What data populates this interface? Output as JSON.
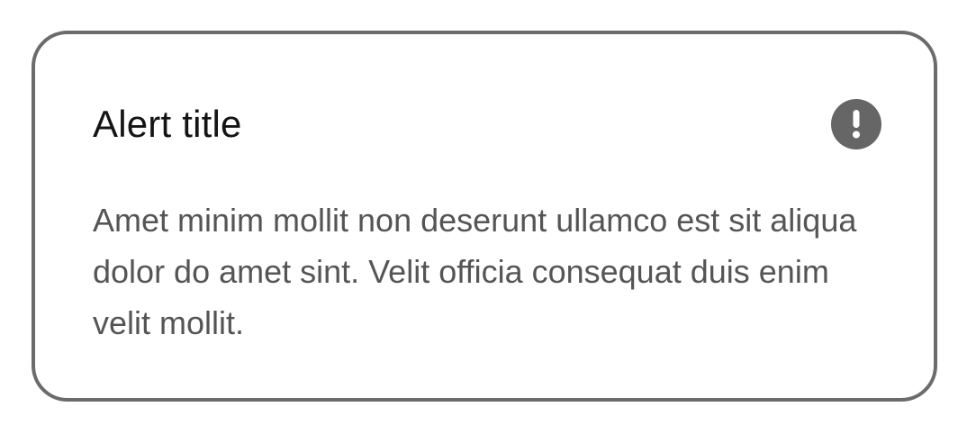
{
  "alert": {
    "title": "Alert title",
    "icon": "exclamation-circle-icon",
    "message": "Amet minim mollit non deserunt ullamco est sit aliqua dolor do amet sint. Velit officia consequat duis enim velit mollit."
  },
  "colors": {
    "border": "#6b6b6b",
    "icon_background": "#666666",
    "title_text": "#141414",
    "body_text": "#555555"
  }
}
